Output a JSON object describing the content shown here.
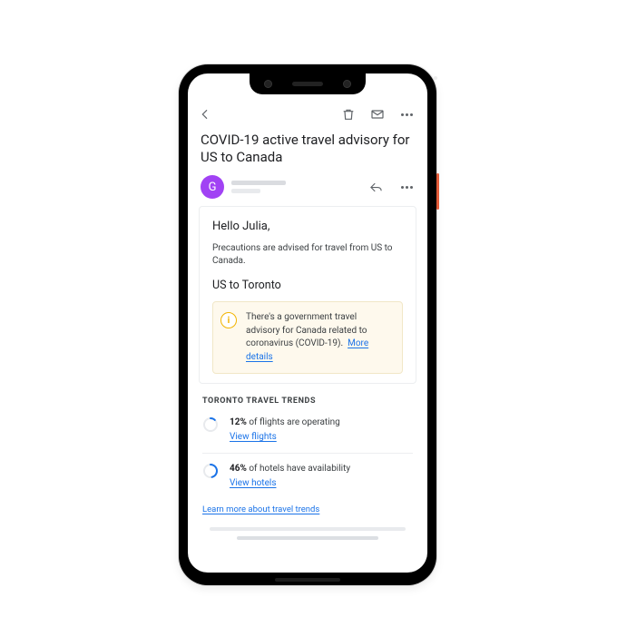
{
  "avatar_initial": "G",
  "subject": "COVID-19 active travel advisory for US to Canada",
  "body": {
    "greeting": "Hello Julia,",
    "precaution": "Precautions are advised for travel from US to Canada.",
    "route": "US to Toronto",
    "advisory_text": "There's a government travel advisory for Canada related to coronavirus (COVID-19).",
    "advisory_link": "More details"
  },
  "trends": {
    "title": "TORONTO TRAVEL TRENDS",
    "items": [
      {
        "percent": 12,
        "text_prefix": "12%",
        "text_rest": " of flights are operating",
        "link": "View flights",
        "ring_color": "#1a73e8"
      },
      {
        "percent": 46,
        "text_prefix": "46%",
        "text_rest": " of hotels have availability",
        "link": "View hotels",
        "ring_color": "#1a73e8"
      }
    ],
    "learn_more": "Learn more about travel trends"
  }
}
